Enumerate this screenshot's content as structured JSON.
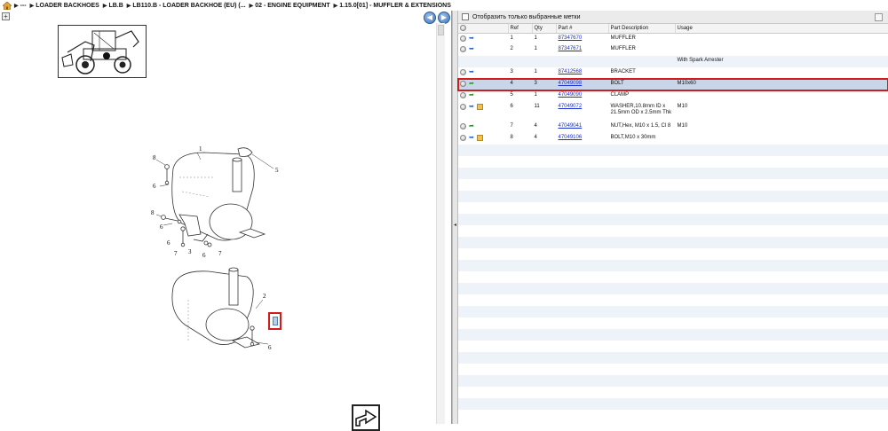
{
  "breadcrumb": {
    "items": [
      "---",
      "LOADER BACKHOES",
      "LB.B",
      "LB110.B - LOADER BACKHOE (EU) (...",
      "02 - ENGINE EQUIPMENT",
      "1.15.0[01] - MUFFLER & EXTENSIONS"
    ]
  },
  "left": {
    "callouts": [
      "1",
      "8",
      "6",
      "8",
      "6",
      "6",
      "7",
      "3",
      "6",
      "7",
      "5",
      "2",
      "6"
    ]
  },
  "right": {
    "filter_label": "Отобразить только выбранные метки",
    "columns": [
      "Ref",
      "Qty",
      "Part #",
      "Part Description",
      "Usage"
    ],
    "rows": [
      {
        "ref": "1",
        "qty": "1",
        "part": "87347670",
        "desc": "MUFFLER",
        "desc2": "",
        "usage": ""
      },
      {
        "ref": "2",
        "qty": "1",
        "part": "87347671",
        "desc": "MUFFLER",
        "desc2": "",
        "usage": ""
      },
      {
        "ref": "",
        "qty": "",
        "part": "",
        "desc": "",
        "desc2": "",
        "usage": "With Spark Arrester"
      },
      {
        "ref": "3",
        "qty": "1",
        "part": "87412568",
        "desc": "BRACKET",
        "desc2": "",
        "usage": ""
      },
      {
        "ref": "4",
        "qty": "3",
        "part": "47049098",
        "desc": "BOLT",
        "desc2": "",
        "usage": "M10x60"
      },
      {
        "ref": "5",
        "qty": "1",
        "part": "47049090",
        "desc": "CLAMP",
        "desc2": "",
        "usage": ""
      },
      {
        "ref": "6",
        "qty": "11",
        "part": "47049072",
        "desc": "WASHER,10.8mm ID x",
        "desc2": "21.5mm OD x 2.5mm Thk",
        "usage": "M10"
      },
      {
        "ref": "7",
        "qty": "4",
        "part": "47049041",
        "desc": "NUT,Hex, M10 x 1.5, Cl 8",
        "desc2": "",
        "usage": "M10"
      },
      {
        "ref": "8",
        "qty": "4",
        "part": "47049106",
        "desc": "BOLT,M10 x 30mm",
        "desc2": "",
        "usage": ""
      }
    ]
  },
  "colors": {
    "selection_outline": "#d21b1b",
    "link": "#1a2fd0",
    "row_alt": "#eef3fa",
    "selected_row": "#c9d6ea"
  }
}
